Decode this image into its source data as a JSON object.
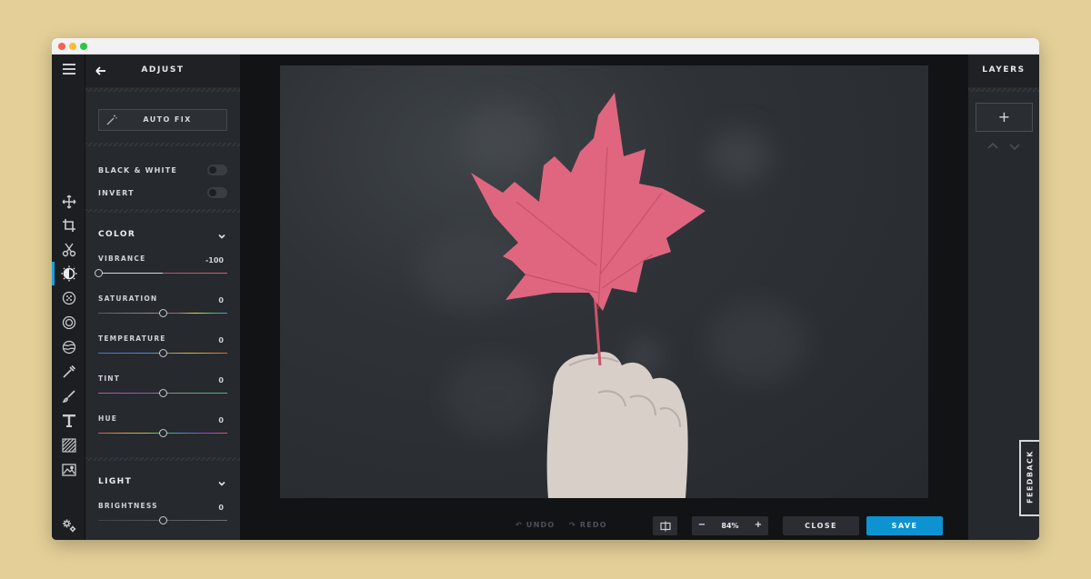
{
  "panel": {
    "title": "ADJUST",
    "auto_fix": "AUTO FIX",
    "toggles": [
      {
        "label": "BLACK & WHITE",
        "on": false
      },
      {
        "label": "INVERT",
        "on": false
      }
    ],
    "color_section": {
      "title": "COLOR",
      "sliders": [
        {
          "label": "VIBRANCE",
          "value": "-100",
          "level": 0.0
        },
        {
          "label": "SATURATION",
          "value": "0",
          "level": 0.5
        },
        {
          "label": "TEMPERATURE",
          "value": "0",
          "level": 0.5
        },
        {
          "label": "TINT",
          "value": "0",
          "level": 0.5
        },
        {
          "label": "HUE",
          "value": "0",
          "level": 0.5
        }
      ]
    },
    "light_section": {
      "title": "LIGHT",
      "sliders": [
        {
          "label": "BRIGHTNESS",
          "value": "0",
          "level": 0.5
        }
      ]
    }
  },
  "toolbar": {
    "items": [
      "menu-icon",
      "move-icon",
      "crop-icon",
      "cut-icon",
      "adjust-icon",
      "filter-icon",
      "vignette-icon",
      "texture-icon",
      "picker-icon",
      "brush-icon",
      "text-icon",
      "pattern-icon",
      "image-icon",
      "settings-icon"
    ],
    "active": "adjust-icon"
  },
  "bottom": {
    "undo": "UNDO",
    "redo": "REDO",
    "zoom_minus": "−",
    "zoom_value": "84%",
    "zoom_plus": "+",
    "close": "CLOSE",
    "save": "SAVE"
  },
  "layers": {
    "title": "LAYERS",
    "add": "+"
  },
  "feedback": "FEEDBACK",
  "colors": {
    "accent": "#0d93d2",
    "active_bar": "#1aa3e0",
    "leaf": "#e0667f"
  }
}
